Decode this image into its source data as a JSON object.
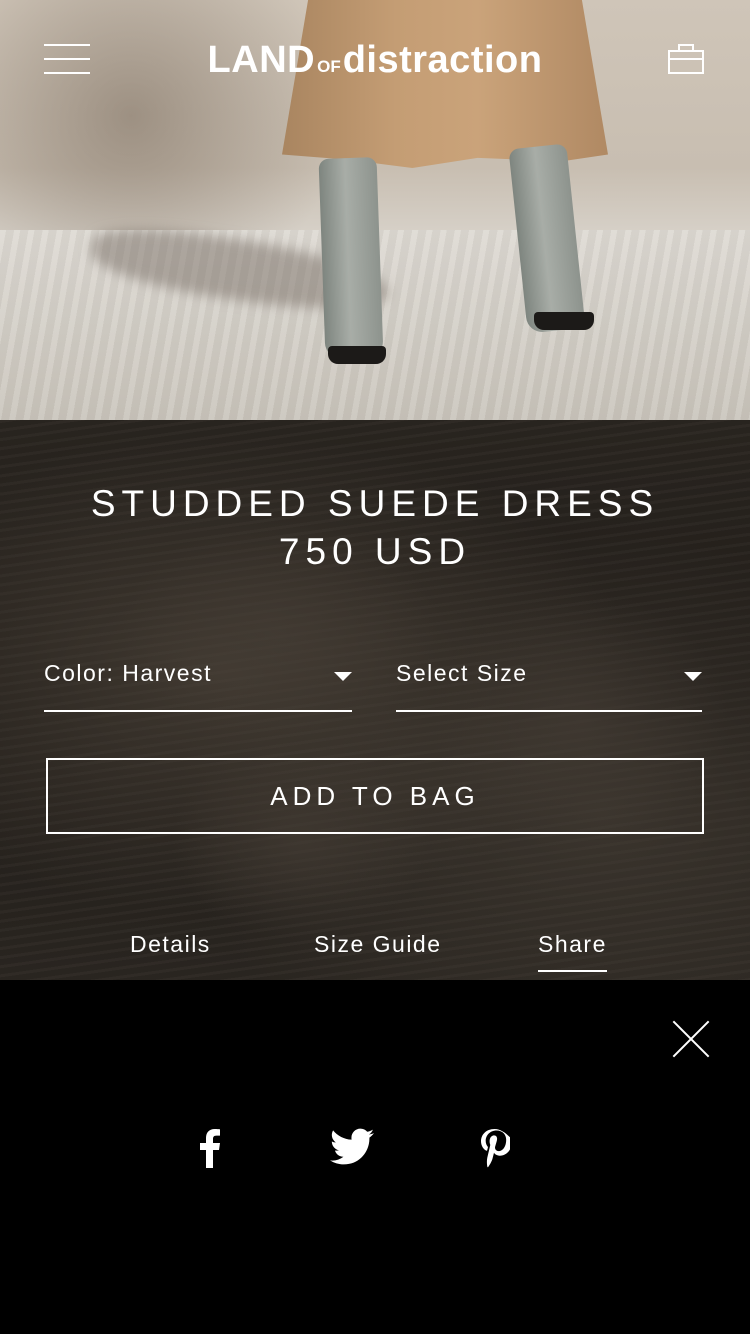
{
  "header": {
    "logo_land": "LAND",
    "logo_of": "OF",
    "logo_distraction": "distraction",
    "menu_icon": "hamburger-menu-icon",
    "bag_icon": "shopping-bag-icon"
  },
  "product": {
    "title": "STUDDED SUEDE DRESS",
    "price": "750 USD"
  },
  "selectors": {
    "color_label": "Color: Harvest",
    "size_label": "Select Size"
  },
  "actions": {
    "add_to_bag": "ADD TO BAG"
  },
  "tabs": [
    {
      "label": "Details",
      "active": false
    },
    {
      "label": "Size Guide",
      "active": false
    },
    {
      "label": "Share",
      "active": true
    }
  ],
  "share": {
    "close_icon": "close-icon",
    "networks": [
      "facebook-icon",
      "twitter-icon",
      "pinterest-icon"
    ]
  },
  "colors": {
    "text": "#ffffff",
    "panel": "#24201c",
    "sheet": "#000000"
  }
}
